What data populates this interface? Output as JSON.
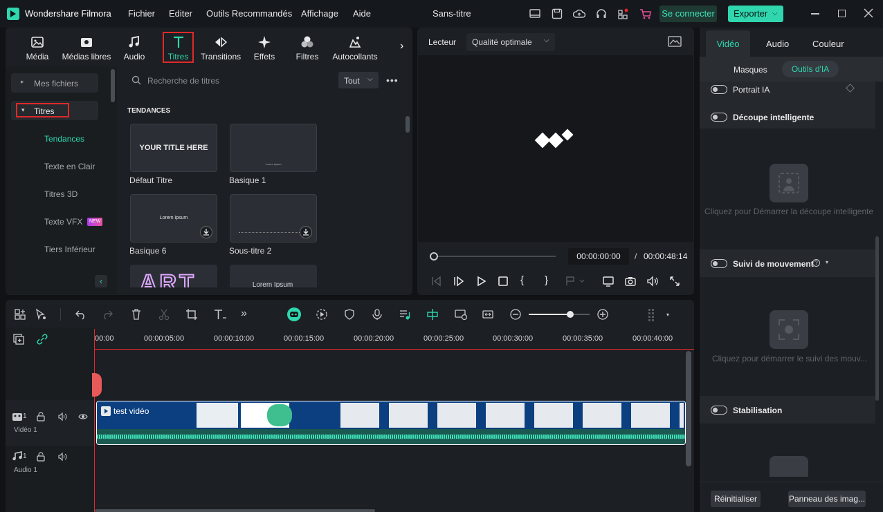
{
  "app": {
    "name": "Wondershare Filmora",
    "project_title": "Sans-titre"
  },
  "menu": [
    "Fichier",
    "Editer",
    "Outils Recommandés",
    "Affichage",
    "Aide"
  ],
  "header": {
    "login_label": "Se connecter",
    "export_label": "Exporter"
  },
  "toolbar": {
    "tools": [
      "Média",
      "Médias libres",
      "Audio",
      "Titres",
      "Transitions",
      "Effets",
      "Filtres",
      "Autocollants"
    ],
    "active": "Titres"
  },
  "sidebar": {
    "my_files": "Mes fichiers",
    "titles": "Titres",
    "items": [
      "Tendances",
      "Texte en Clair",
      "Titres 3D",
      "Texte VFX",
      "Tiers Inférieur"
    ],
    "new_badge": "NEW"
  },
  "library": {
    "search_placeholder": "Recherche de titres",
    "filter": "Tout",
    "section": "TENDANCES",
    "thumbs": [
      {
        "label": "Défaut Titre",
        "preview": "YOUR TITLE HERE"
      },
      {
        "label": "Basique 1",
        "preview": "Lorem ipsum"
      },
      {
        "label": "Basique 6",
        "preview": "Lorem ipsum"
      },
      {
        "label": "Sous-titre 2",
        "preview": ""
      },
      {
        "label": "",
        "preview": "ART"
      },
      {
        "label": "",
        "preview": "Lorem Ipsum"
      }
    ]
  },
  "player": {
    "label": "Lecteur",
    "quality": "Qualité optimale",
    "current_time": "00:00:00:00",
    "separator": "/",
    "total_time": "00:00:48:14",
    "progress": 0
  },
  "timeline": {
    "ticks": [
      "00:00",
      "00:00:05:00",
      "00:00:10:00",
      "00:00:15:00",
      "00:00:20:00",
      "00:00:25:00",
      "00:00:30:00",
      "00:00:35:00",
      "00:00:40:00"
    ],
    "video_track": {
      "num": "1",
      "name": "Vidéo 1"
    },
    "audio_track": {
      "num": "1",
      "name": "Audio 1"
    },
    "clip_label": "test vidéo",
    "zoom": 0.68
  },
  "right_panel": {
    "tabs": [
      "Vidéo",
      "Audio",
      "Couleur"
    ],
    "active_tab": "Vidéo",
    "subtabs": [
      "Masques",
      "Outils d'IA"
    ],
    "active_subtab": "Outils d'IA",
    "portrait": "Portrait IA",
    "smart_cut": "Découpe intelligente",
    "smart_cut_hint": "Cliquez pour Démarrer la découpe intelligente",
    "motion": "Suivi de mouvement",
    "motion_hint": "Cliquez pour démarrer le suivi des mouv...",
    "stabilization": "Stabilisation",
    "reset": "Réinitialiser",
    "keyframe": "Panneau des imag..."
  },
  "colors": {
    "accent": "#2fd6ae",
    "highlight": "#e02a2a",
    "preview_bg": "#0b3f80"
  }
}
